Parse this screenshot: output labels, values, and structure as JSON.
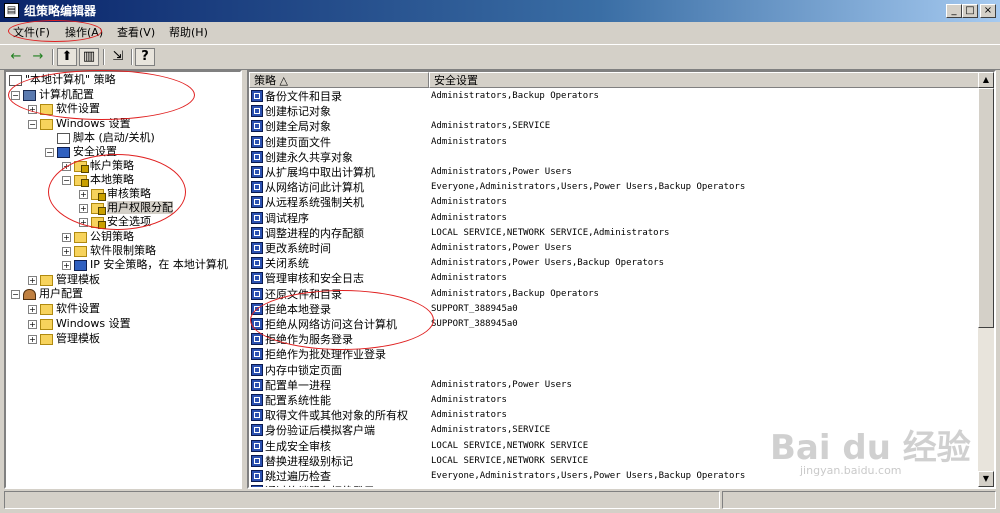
{
  "window": {
    "title": "组策略编辑器",
    "controls": {
      "minimize": "_",
      "maximize": "□",
      "close": "×"
    }
  },
  "menu": [
    {
      "label": "文件(F)"
    },
    {
      "label": "操作(A)"
    },
    {
      "label": "查看(V)"
    },
    {
      "label": "帮助(H)"
    }
  ],
  "toolbar": {
    "back": "←",
    "forward": "→",
    "up": "⬆",
    "show_tree": "▥",
    "export": "⇲",
    "help": "?"
  },
  "tree": {
    "root": "\"本地计算机\" 策略",
    "computer_config": "计算机配置",
    "cc_software": "软件设置",
    "cc_windows": "Windows 设置",
    "scripts": "脚本 (启动/关机)",
    "security": "安全设置",
    "account_policies": "帐户策略",
    "local_policies": "本地策略",
    "audit_policy": "审核策略",
    "user_rights": "用户权限分配",
    "security_options": "安全选项",
    "public_key": "公钥策略",
    "software_restriction": "软件限制策略",
    "ip_security": "IP 安全策略，在 本地计算机",
    "cc_admin_templates": "管理模板",
    "user_config": "用户配置",
    "uc_software": "软件设置",
    "uc_windows": "Windows 设置",
    "uc_admin_templates": "管理模板",
    "expanders": {
      "plus": "+",
      "minus": "−"
    }
  },
  "table": {
    "headers": {
      "policy": "策略 △",
      "setting": "安全设置"
    },
    "rows": [
      {
        "policy": "备份文件和目录",
        "setting": "Administrators,Backup Operators"
      },
      {
        "policy": "创建标记对象",
        "setting": ""
      },
      {
        "policy": "创建全局对象",
        "setting": "Administrators,SERVICE"
      },
      {
        "policy": "创建页面文件",
        "setting": "Administrators"
      },
      {
        "policy": "创建永久共享对象",
        "setting": ""
      },
      {
        "policy": "从扩展坞中取出计算机",
        "setting": "Administrators,Power Users"
      },
      {
        "policy": "从网络访问此计算机",
        "setting": "Everyone,Administrators,Users,Power Users,Backup Operators"
      },
      {
        "policy": "从远程系统强制关机",
        "setting": "Administrators"
      },
      {
        "policy": "调试程序",
        "setting": "Administrators"
      },
      {
        "policy": "调整进程的内存配额",
        "setting": "LOCAL SERVICE,NETWORK SERVICE,Administrators"
      },
      {
        "policy": "更改系统时间",
        "setting": "Administrators,Power Users"
      },
      {
        "policy": "关闭系统",
        "setting": "Administrators,Power Users,Backup Operators"
      },
      {
        "policy": "管理审核和安全日志",
        "setting": "Administrators"
      },
      {
        "policy": "还原文件和目录",
        "setting": "Administrators,Backup Operators"
      },
      {
        "policy": "拒绝本地登录",
        "setting": "SUPPORT_388945a0"
      },
      {
        "policy": "拒绝从网络访问这台计算机",
        "setting": "SUPPORT_388945a0"
      },
      {
        "policy": "拒绝作为服务登录",
        "setting": ""
      },
      {
        "policy": "拒绝作为批处理作业登录",
        "setting": ""
      },
      {
        "policy": "内存中锁定页面",
        "setting": ""
      },
      {
        "policy": "配置单一进程",
        "setting": "Administrators,Power Users"
      },
      {
        "policy": "配置系统性能",
        "setting": "Administrators"
      },
      {
        "policy": "取得文件或其他对象的所有权",
        "setting": "Administrators"
      },
      {
        "policy": "身份验证后模拟客户端",
        "setting": "Administrators,SERVICE"
      },
      {
        "policy": "生成安全审核",
        "setting": "LOCAL SERVICE,NETWORK SERVICE"
      },
      {
        "policy": "替换进程级别标记",
        "setting": "LOCAL SERVICE,NETWORK SERVICE"
      },
      {
        "policy": "跳过遍历检查",
        "setting": "Everyone,Administrators,Users,Power Users,Backup Operators"
      },
      {
        "policy": "通过终端服务拒绝登录",
        "setting": ""
      }
    ]
  },
  "scrollbar": {
    "up": "▲",
    "down": "▼"
  },
  "watermark": {
    "brand": "Bai du 经验",
    "url": "jingyan.baidu.com"
  },
  "colors": {
    "title_start": "#0a246a",
    "title_end": "#a6caf0",
    "annotation": "#e02020",
    "icon_blue": "#2a50b0",
    "folder": "#f7d35c"
  }
}
